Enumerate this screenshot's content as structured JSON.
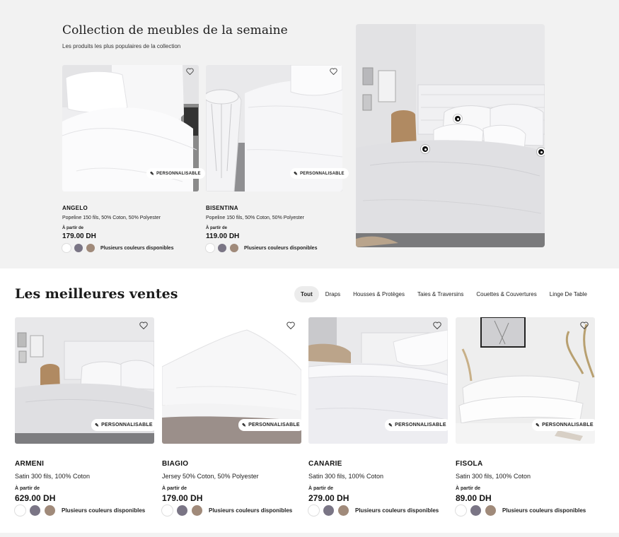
{
  "featured": {
    "title": "Collection de meubles de la semaine",
    "subtitle": "Les produits les plus populaires de la collection",
    "products": [
      {
        "name": "ANGELO",
        "desc": "Popeline 150 fils, 50% Coton, 50% Polyester",
        "from_label": "À partir de",
        "price": "179.00 DH",
        "badge": "PERSONNALISABLE",
        "colors_label": "Plusieurs couleurs disponibles"
      },
      {
        "name": "BISENTINA",
        "desc": "Popeline 150 fils, 50% Coton, 50% Polyester",
        "from_label": "À partir de",
        "price": "119.00 DH",
        "badge": "PERSONNALISABLE",
        "colors_label": "Plusieurs couleurs disponibles"
      }
    ]
  },
  "bestsellers": {
    "title": "Les meilleures ventes",
    "tabs": [
      "Tout",
      "Draps",
      "Housses & Protèges",
      "Taies & Traversins",
      "Couettes & Couvertures",
      "Linge De Table"
    ],
    "active_tab": "Tout",
    "products": [
      {
        "name": "ARMENI",
        "desc": "Satin 300 fils, 100% Coton",
        "from_label": "À partir de",
        "price": "629.00 DH",
        "badge": "PERSONNALISABLE",
        "colors_label": "Plusieurs couleurs disponibles"
      },
      {
        "name": "BIAGIO",
        "desc": "Jersey 50% Coton, 50% Polyester",
        "from_label": "À partir de",
        "price": "179.00 DH",
        "badge": "PERSONNALISABLE",
        "colors_label": "Plusieurs couleurs disponibles"
      },
      {
        "name": "CANARIE",
        "desc": "Satin 300 fils, 100% Coton",
        "from_label": "À partir de",
        "price": "279.00 DH",
        "badge": "PERSONNALISABLE",
        "colors_label": "Plusieurs couleurs disponibles"
      },
      {
        "name": "FISOLA",
        "desc": "Satin 300 fils, 100% Coton",
        "from_label": "À partir de",
        "price": "89.00 DH",
        "badge": "PERSONNALISABLE",
        "colors_label": "Plusieurs couleurs disponibles"
      }
    ]
  },
  "swatch_colors": [
    "#ffffff",
    "#7a7585",
    "#a08a7a"
  ],
  "icons": {
    "favorite": "heart-outline-icon",
    "customize": "magic-wand-icon",
    "hotspot": "hotspot-dot-icon"
  }
}
